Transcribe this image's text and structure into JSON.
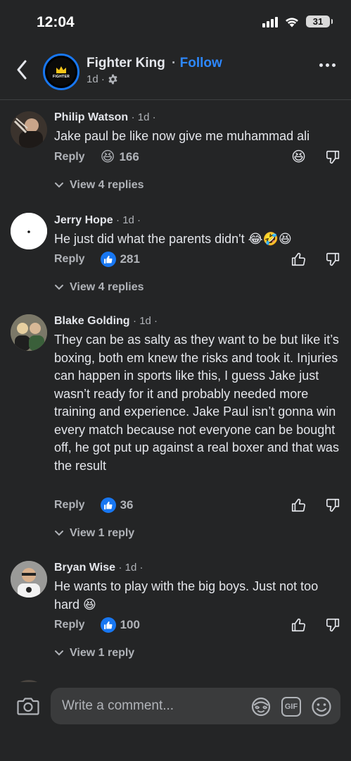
{
  "status": {
    "time": "12:04",
    "battery": "31"
  },
  "header": {
    "page_name": "Fighter King",
    "follow_sep": "·",
    "follow_label": "Follow",
    "post_time": "1d ·",
    "avatar_logo_text": "FIGHTER"
  },
  "comments": [
    {
      "author": "Philip Watson",
      "time": "· 1d ·",
      "text": "Jake paul be like now give me muhammad ali",
      "reply_label": "Reply",
      "reaction": "haha",
      "count": "166",
      "view_replies": "View 4 replies"
    },
    {
      "author": "Jerry Hope",
      "time": "· 1d ·",
      "text": "He just did what the parents didn't 😂🤣😆",
      "reply_label": "Reply",
      "reaction": "like",
      "count": "281",
      "view_replies": "View 4 replies"
    },
    {
      "author": "Blake Golding",
      "time": "· 1d ·",
      "text": "They can be as salty as they want to be but like it’s boxing, both em knew the risks and took it. Injuries can happen in sports like this, I guess Jake just wasn’t ready for it and probably needed more training and experience. Jake Paul isn’t gonna win every match because not everyone can be bought off, he got put up against a real boxer and that was the result",
      "reply_label": "Reply",
      "reaction": "like",
      "count": "36",
      "view_replies": "View 1 reply"
    },
    {
      "author": "Bryan Wise",
      "time": "· 1d ·",
      "text": "He wants to play with the big boys. Just not too hard 😆",
      "reply_label": "Reply",
      "reaction": "like",
      "count": "100",
      "view_replies": "View 1 reply"
    }
  ],
  "composer": {
    "placeholder": "Write a comment...",
    "gif_label": "GIF"
  },
  "colors": {
    "accent": "#2d88ff",
    "like_blue": "#1877f2",
    "background": "#242526",
    "input_bg": "#3a3b3c"
  }
}
